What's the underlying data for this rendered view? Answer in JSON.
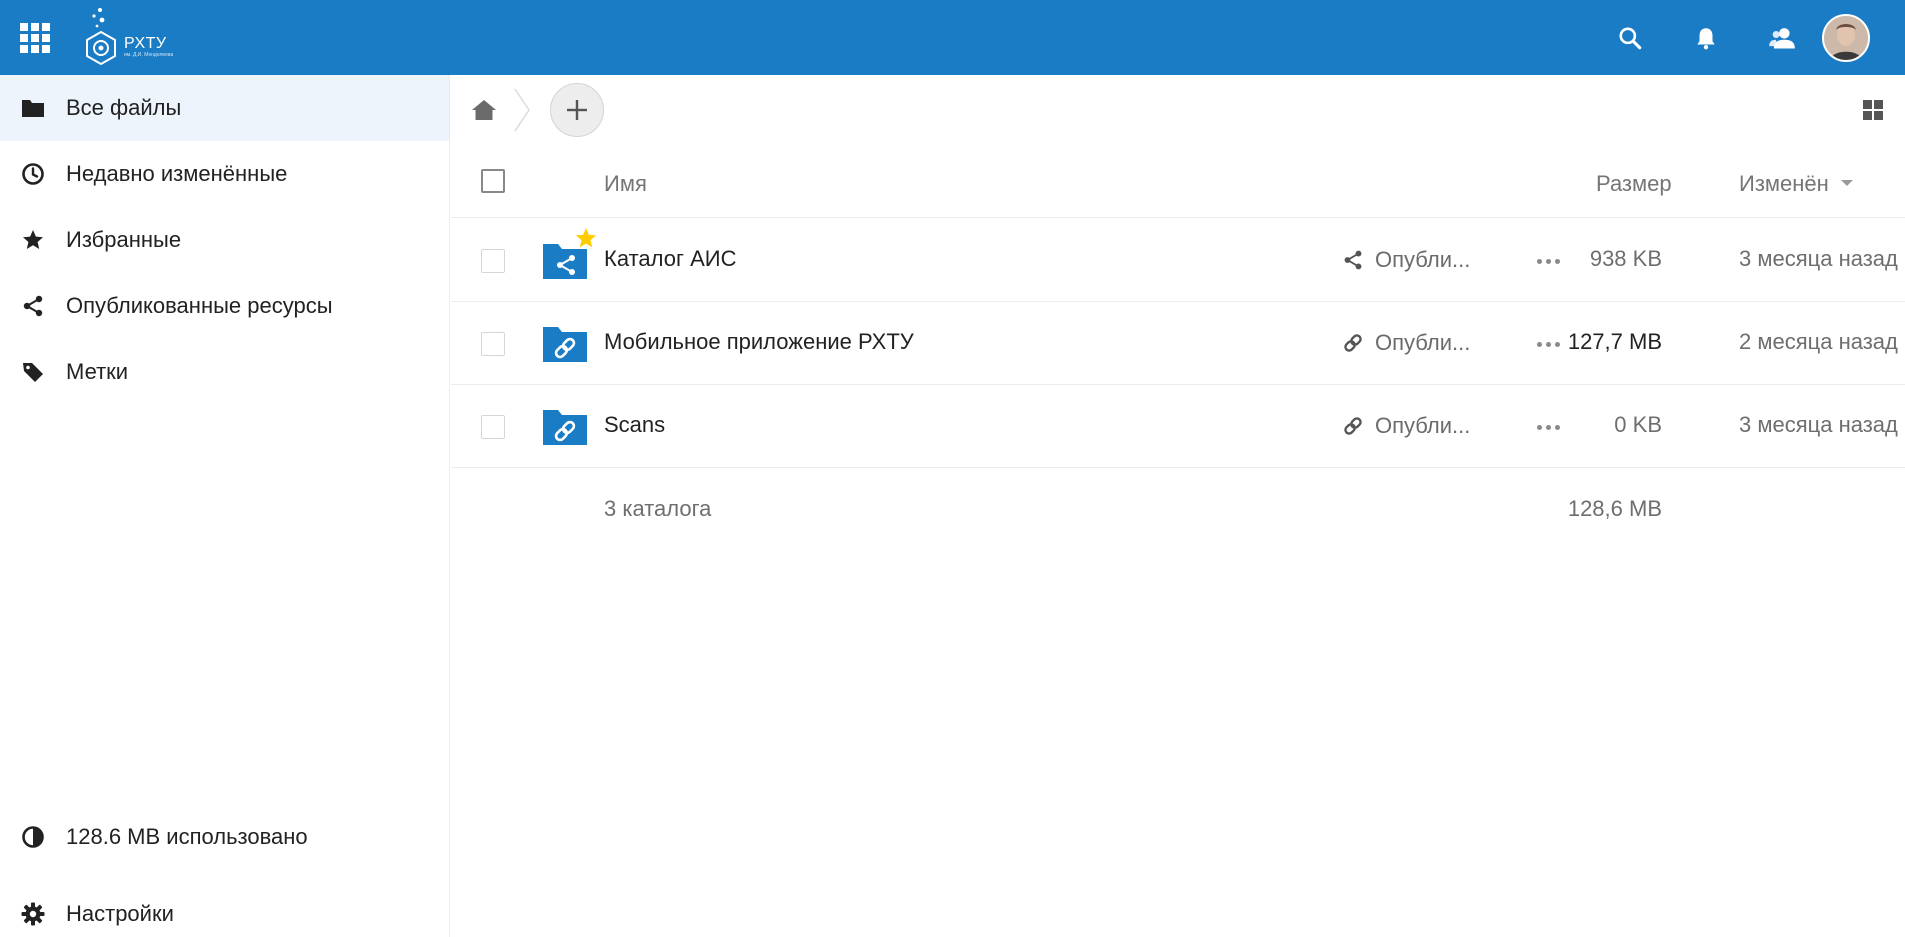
{
  "header": {
    "logo_title": "РХТУ",
    "logo_subtitle": "им. Д.И. Менделеева",
    "brand_color": "#1a7cc5",
    "icons": [
      "apps-icon",
      "search-icon",
      "bell-icon",
      "contacts-icon",
      "avatar"
    ]
  },
  "sidebar": {
    "items": [
      {
        "label": "Все файлы",
        "icon": "folder-icon",
        "active": true
      },
      {
        "label": "Недавно изменённые",
        "icon": "clock-icon"
      },
      {
        "label": "Избранные",
        "icon": "star-icon"
      },
      {
        "label": "Опубликованные ресурсы",
        "icon": "share-icon"
      },
      {
        "label": "Метки",
        "icon": "tag-icon"
      }
    ],
    "quota_label": "128.6 MB использовано",
    "settings_label": "Настройки"
  },
  "breadcrumb": {
    "home_icon": "home-icon",
    "add_icon": "plus-icon",
    "view_icon": "grid-view-icon"
  },
  "table": {
    "columns": {
      "name": "Имя",
      "size": "Размер",
      "modified": "Изменён"
    },
    "rows": [
      {
        "name": "Каталог АИС",
        "folder_icon": "shared-folder-icon",
        "favorite": true,
        "share_icon": "share-icon",
        "share_label": "Опубли...",
        "size": "938 KB",
        "modified": "3 месяца назад",
        "size_color": "#6e6e6e"
      },
      {
        "name": "Мобильное приложение РХТУ",
        "folder_icon": "link-folder-icon",
        "favorite": false,
        "share_icon": "link-icon",
        "share_label": "Опубли...",
        "size": "127,7 MB",
        "modified": "2 месяца назад",
        "size_color": "#222222"
      },
      {
        "name": "Scans",
        "folder_icon": "link-folder-icon",
        "favorite": false,
        "share_icon": "link-icon",
        "share_label": "Опубли...",
        "size": "0 KB",
        "modified": "3 месяца назад",
        "size_color": "#6e6e6e"
      }
    ],
    "summary": {
      "label": "3 каталога",
      "total": "128,6 MB"
    }
  }
}
